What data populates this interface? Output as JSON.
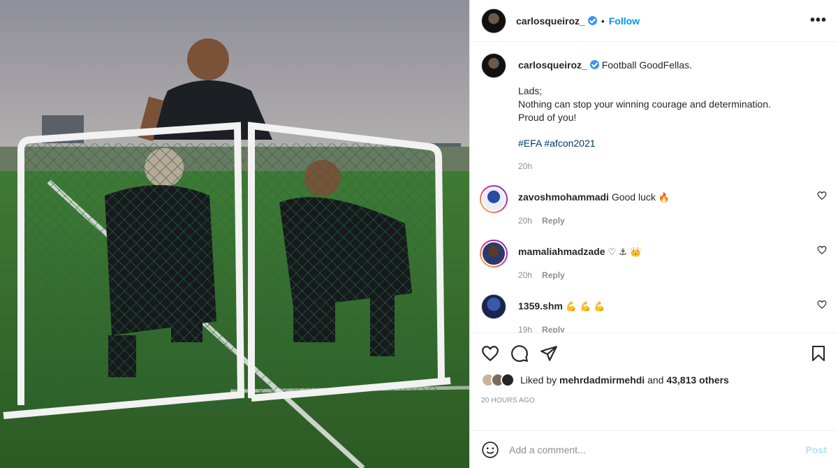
{
  "header": {
    "username": "carlosqueiroz_",
    "follow_label": "Follow",
    "separator": "•",
    "more_label": "•••"
  },
  "caption": {
    "username": "carlosqueiroz_",
    "title": "Football GoodFellas.",
    "body": "Lads;\nNothing can stop your winning courage and determination.\nProud of you!",
    "hashtags": "#EFA #afcon2021",
    "time": "20h"
  },
  "comments": [
    {
      "username": "zavoshmohammadi",
      "text": "Good luck",
      "emoji": "🔥",
      "time": "20h",
      "reply": "Reply"
    },
    {
      "username": "mamaliahmadzade",
      "text": "",
      "emoji": "♡ ⚓ 👑",
      "time": "20h",
      "reply": "Reply"
    },
    {
      "username": "1359.shm",
      "text": "",
      "emoji": "💪 💪 💪",
      "time": "19h",
      "reply": "Reply"
    }
  ],
  "actions": {
    "likes_prefix": "Liked by",
    "liked_by_user": "mehrdadmirmehdi",
    "likes_and": "and",
    "likes_others": "43,813 others",
    "posted_ago": "20 HOURS AGO"
  },
  "add_comment": {
    "placeholder": "Add a comment...",
    "post_label": "Post"
  },
  "colors": {
    "accent": "#0095f6",
    "verified": "#3897f0",
    "post_disabled": "#b2dffc",
    "muted": "#8e8e8e"
  }
}
